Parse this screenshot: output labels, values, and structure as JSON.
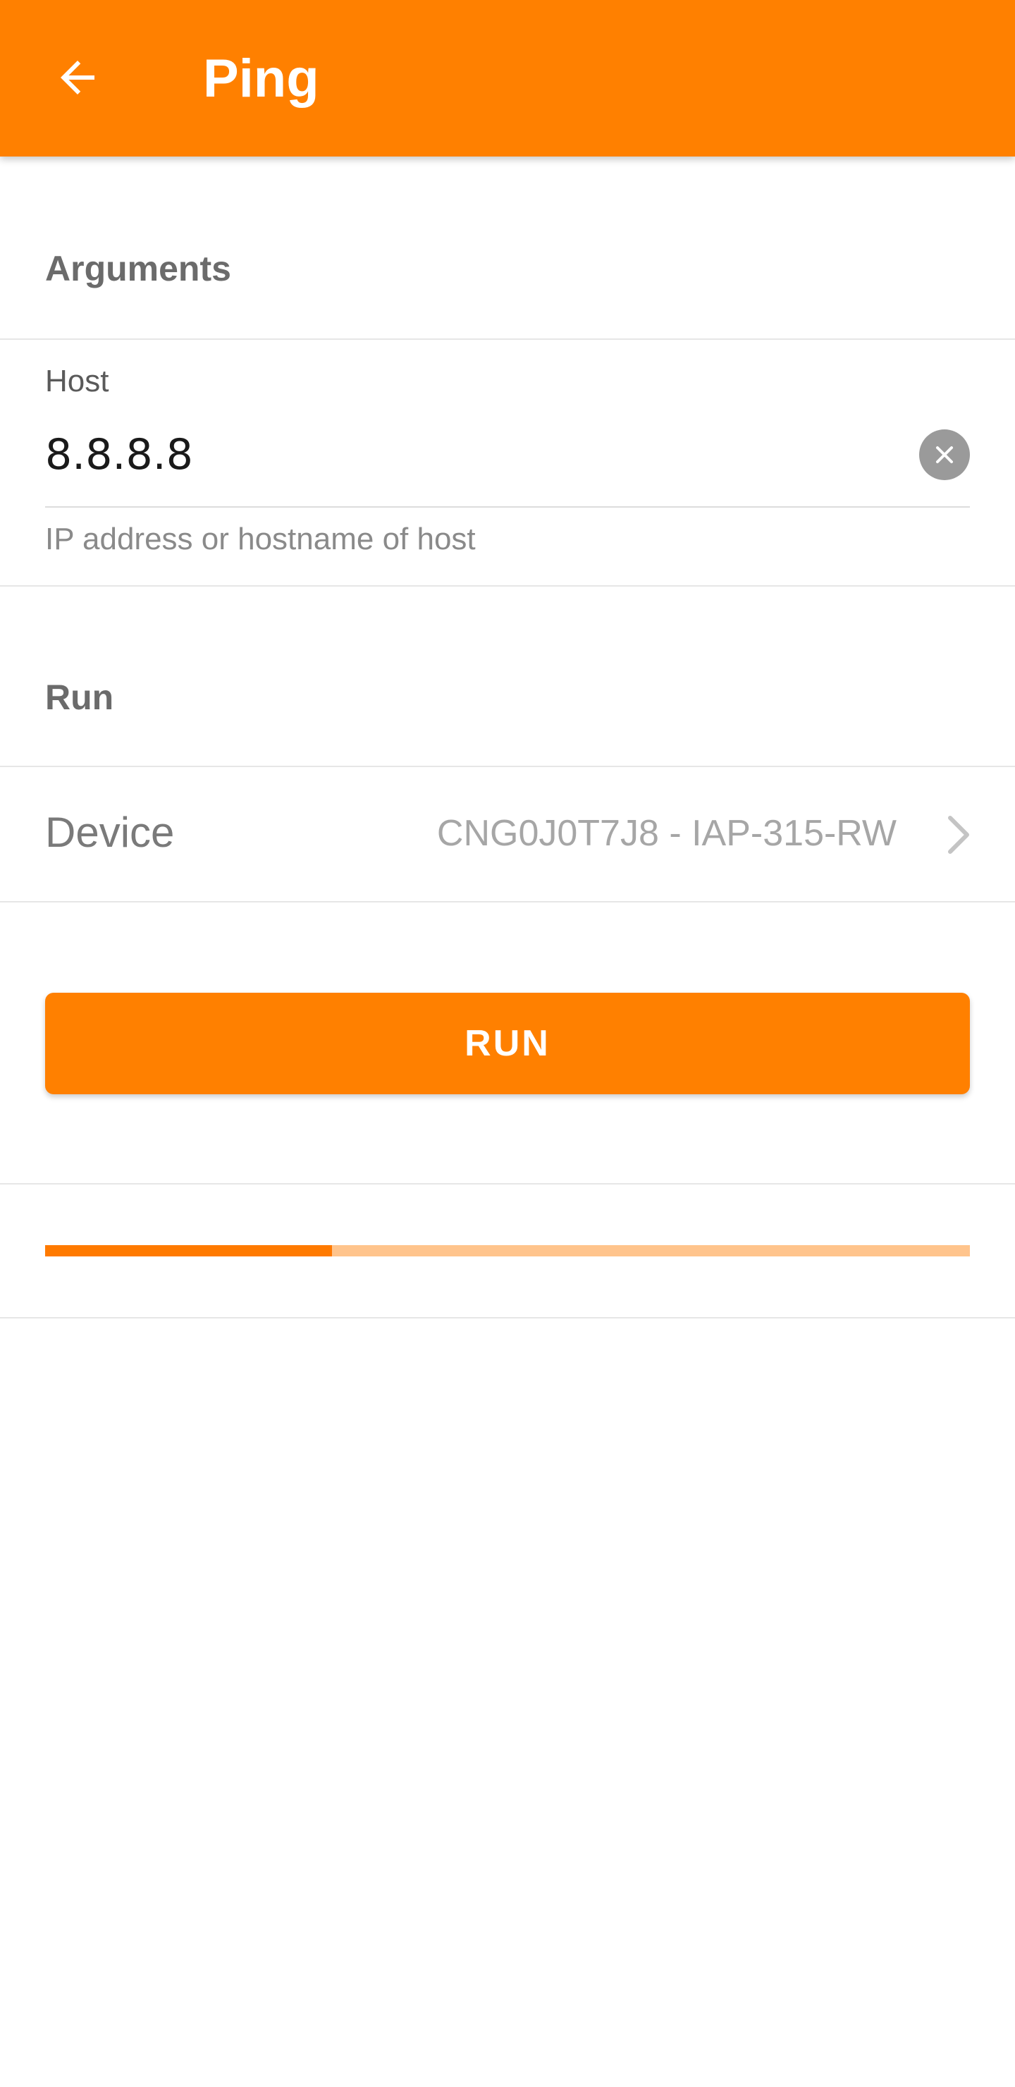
{
  "appbar": {
    "title": "Ping",
    "back_icon": "arrow-left-icon",
    "color": "#ff8000"
  },
  "arguments_section": {
    "title": "Arguments"
  },
  "host": {
    "label": "Host",
    "value": "8.8.8.8",
    "hint": "IP address or hostname of host",
    "clear_icon": "close-icon"
  },
  "run_section": {
    "title": "Run"
  },
  "device": {
    "label": "Device",
    "value": "CNG0J0T7J8 - IAP-315-RW",
    "chevron_icon": "chevron-right-icon"
  },
  "run_button": {
    "label": "RUN"
  },
  "progress": {
    "value": 0.31,
    "fill_color": "#ff7a00",
    "track_color": "#ffc48c"
  }
}
